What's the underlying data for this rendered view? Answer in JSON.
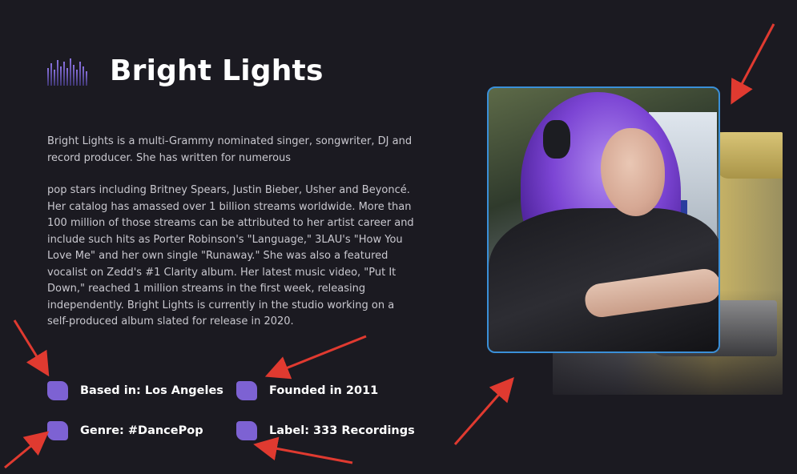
{
  "artist": {
    "name": "Bright Lights",
    "bio": [
      "Bright Lights is a multi-Grammy nominated singer, songwriter, DJ and record producer. She has written for numerous",
      "pop stars including Britney Spears, Justin Bieber, Usher and Beyoncé. Her catalog has amassed over 1 billion streams worldwide. More than 100 million of those streams can be attributed to her artist career and include such hits as Porter Robinson's \"Language,\" 3LAU's \"How You Love Me\" and her own single \"Runaway.\" She was also a featured vocalist on Zedd's #1 Clarity album. Her latest music video, \"Put It Down,\" reached 1 million streams in the first week, releasing independently. Bright Lights is currently in the studio working on a self-produced album slated for release in 2020."
    ],
    "facts": [
      "Based in: Los Angeles",
      "Founded in 2011",
      "Genre: #DancePop",
      "Label: 333 Recordings"
    ]
  },
  "icons": {
    "header": "equalizer-icon",
    "fact": "rounded-square-icon"
  },
  "colors": {
    "background": "#1b1a21",
    "accent": "#7d62d3",
    "photo_border": "#3a8fd8",
    "annotation_arrow": "#e03a30"
  }
}
